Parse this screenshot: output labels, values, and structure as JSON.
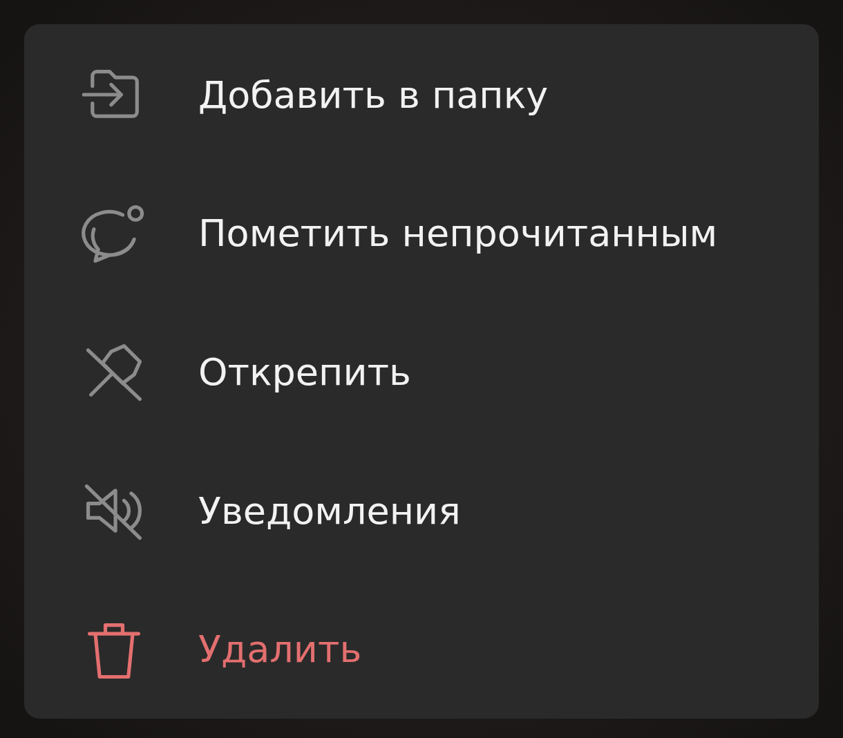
{
  "menu": {
    "items": [
      {
        "label": "Добавить в папку",
        "kind": "folder",
        "destructive": false
      },
      {
        "label": "Пометить непрочитанным",
        "kind": "unread",
        "destructive": false
      },
      {
        "label": "Открепить",
        "kind": "unpin",
        "destructive": false
      },
      {
        "label": "Уведомления",
        "kind": "mute",
        "destructive": false
      },
      {
        "label": "Удалить",
        "kind": "delete",
        "destructive": true
      }
    ]
  }
}
